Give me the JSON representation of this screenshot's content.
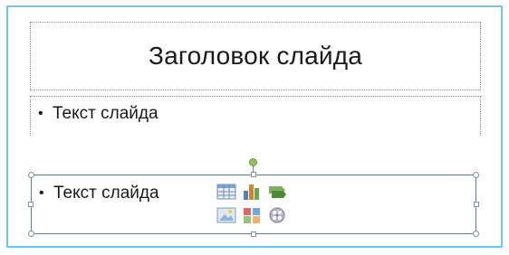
{
  "slide": {
    "title_text": "Заголовок слайда",
    "body_bullet": "Текст слайда",
    "selected_bullet": "Текст слайда"
  },
  "content_insert_icons": [
    "table-icon",
    "chart-icon",
    "smartart-icon",
    "picture-icon",
    "clipart-icon",
    "media-clip-icon"
  ],
  "colors": {
    "frame_border": "#6ec9ea",
    "selection_border": "#5a7db0",
    "rotate_handle": "#8fbf5a"
  }
}
